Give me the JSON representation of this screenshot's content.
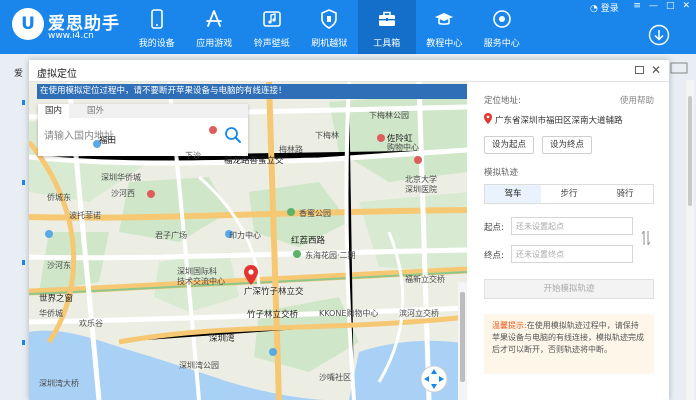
{
  "app": {
    "logo_mark": "U",
    "logo_title": "爱思助手",
    "logo_url": "www.i4.cn",
    "login": "登录",
    "window_controls": [
      "≡",
      "—",
      "□",
      "✕"
    ]
  },
  "nav": {
    "items": [
      {
        "label": "我的设备",
        "icon": "phone-icon"
      },
      {
        "label": "应用游戏",
        "icon": "appstore-icon"
      },
      {
        "label": "铃声壁纸",
        "icon": "music-icon"
      },
      {
        "label": "刷机越狱",
        "icon": "shield-icon"
      },
      {
        "label": "工具箱",
        "icon": "toolbox-icon"
      },
      {
        "label": "教程中心",
        "icon": "graduation-cap-icon"
      },
      {
        "label": "服务中心",
        "icon": "support-icon"
      }
    ],
    "active_index": 4
  },
  "background": {
    "tab_label": "爱"
  },
  "dialog": {
    "title": "虚拟定位",
    "map": {
      "warning": "在使用模拟定位过程中，请不要断开苹果设备与电脑的有线连接！",
      "search_tabs": [
        "国内",
        "国外"
      ],
      "search_placeholder": "请输入国内地址",
      "current_location_label": "广深竹子林立交",
      "labels": [
        {
          "text": "福田"
        },
        {
          "text": "下梅林公园"
        },
        {
          "text": "下梅林"
        },
        {
          "text": "下沙"
        },
        {
          "text": "梅林路"
        },
        {
          "text": "佐阾虹"
        },
        {
          "text": "购物中心"
        },
        {
          "text": "福龙路香蜜立交"
        },
        {
          "text": "北京大学"
        },
        {
          "text": "深圳医院"
        },
        {
          "text": "深圳华侨城"
        },
        {
          "text": "香蜜公园"
        },
        {
          "text": "沙河西"
        },
        {
          "text": "侨城东"
        },
        {
          "text": "君子广场"
        },
        {
          "text": "印力中心"
        },
        {
          "text": "红荔西路"
        },
        {
          "text": "东海花园·二期"
        },
        {
          "text": "福新立交桥"
        },
        {
          "text": "深圳国际科"
        },
        {
          "text": "技术交流中心"
        },
        {
          "text": "世界之窗"
        },
        {
          "text": "华侨城"
        },
        {
          "text": "竹子林立交桥"
        },
        {
          "text": "KKONE购物中心"
        },
        {
          "text": "滨河立交桥"
        },
        {
          "text": "深圳湾"
        },
        {
          "text": "深圳湾公园"
        },
        {
          "text": "沙嘴社区"
        },
        {
          "text": "欢乐谷"
        },
        {
          "text": "沙河东"
        },
        {
          "text": "波托菲诺"
        },
        {
          "text": "深圳湾大桥"
        }
      ]
    },
    "panel": {
      "location_label": "定位地址:",
      "help": "使用帮助",
      "address": "广东省深圳市福田区深南大道辅路",
      "set_start": "设为起点",
      "set_end": "设为终点",
      "route_label": "模拟轨迹",
      "modes": [
        "驾车",
        "步行",
        "骑行"
      ],
      "active_mode": 0,
      "start_label": "起点:",
      "start_placeholder": "还未设置起点",
      "end_label": "终点:",
      "end_placeholder": "还未设置终点",
      "start_route_button": "开始模拟轨迹",
      "notice_title": "温馨提示:",
      "notice_text": "在使用模拟轨迹过程中，请保持苹果设备与电脑的有线连接，模拟轨迹完成后才可以断开，否则轨迹将中断。"
    }
  },
  "colors": {
    "brand": "#1a86ec",
    "brand_dark": "#136fca",
    "map_water": "#a9d0f5",
    "map_park": "#cfe6c8",
    "map_road": "#ffffff",
    "map_highway": "#f7c873",
    "pin": "#e3342f"
  }
}
